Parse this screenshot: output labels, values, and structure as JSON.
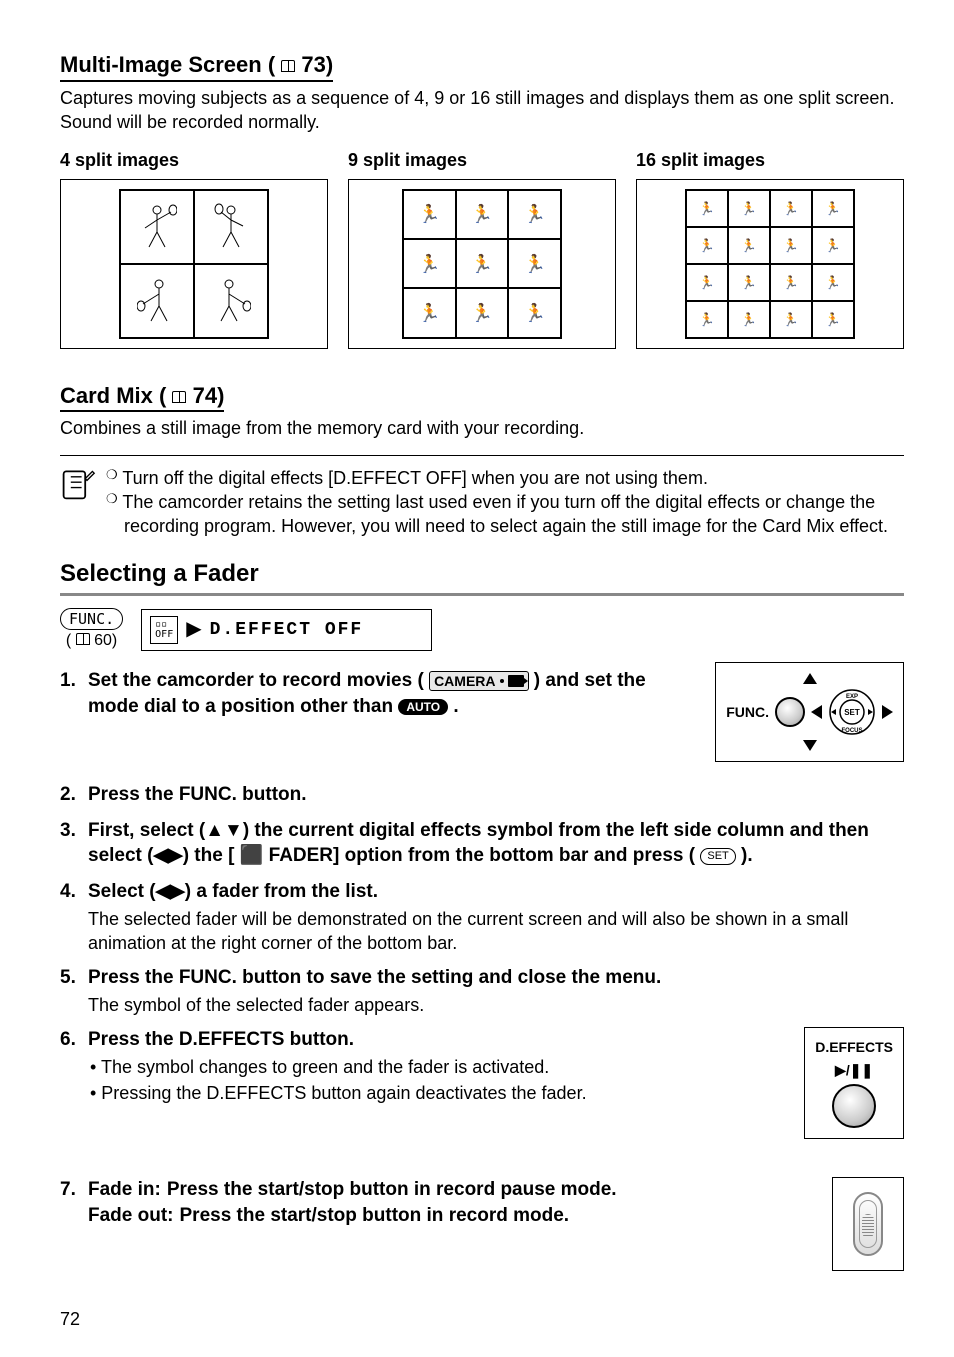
{
  "sections": {
    "multi_image": {
      "heading": "Multi-Image Screen (",
      "heading_ref": "73)",
      "body": "Captures moving subjects as a sequence of 4, 9 or 16 still images and displays them as one split screen. Sound will be recorded normally.",
      "splits": {
        "four": "4 split images",
        "nine": "9 split images",
        "sixteen": "16 split images"
      }
    },
    "card_mix": {
      "heading": "Card Mix (",
      "heading_ref": "74)",
      "body": "Combines a still image from the memory card with your recording.",
      "notes": {
        "bullet": "❍",
        "n1": "Turn off the digital effects [D.EFFECT OFF] when you are not using them.",
        "n2": "The camcorder retains the setting last used even if you turn off the digital effects or change the recording program. However, you will need to select again the still image for the Card Mix effect."
      }
    },
    "fader": {
      "heading": "Selecting a Fader",
      "func_label": "FUNC.",
      "func_ref": "60)",
      "eff_small": "OFF",
      "eff_text": "D.EFFECT OFF",
      "steps": {
        "s1a": "Set the camcorder to record movies (",
        "s1_cam": "CAMERA",
        "s1b": ") and set the mode dial to a position other than ",
        "s1_auto": "AUTO",
        "s1c": ".",
        "s2": "Press the FUNC. button.",
        "s3": "First, select (▲▼) the current digital effects symbol from the left side column and then select (◀▶) the [ ⬛ FADER] option from the bottom bar and press ( ",
        "s3_set": "SET",
        "s3b": " ).",
        "s4": "Select (◀▶) a fader from the list.",
        "s4_sub": "The selected fader will be demonstrated on the current screen and will also be shown in a small animation at the right corner of the bottom bar.",
        "s5": "Press the FUNC. button to save the setting and close the menu.",
        "s5_sub": "The symbol of the selected fader appears.",
        "s6": "Press the D.EFFECTS button.",
        "s6_b1": "• The symbol changes to green and the fader is activated.",
        "s6_b2": "• Pressing the D.EFFECTS button again deactivates the fader.",
        "s7_in_label": "Fade in:",
        "s7_in": "Press the start/stop button in record pause mode.",
        "s7_out_label": "Fade out:",
        "s7_out": "Press the start/stop button in record mode."
      },
      "diagram": {
        "func": "FUNC.",
        "deffects": "D.EFFECTS",
        "play": "▶/❚❚",
        "exp": "EXP",
        "set": "SET",
        "focus": "FOCUS"
      }
    }
  },
  "page_number": "72"
}
